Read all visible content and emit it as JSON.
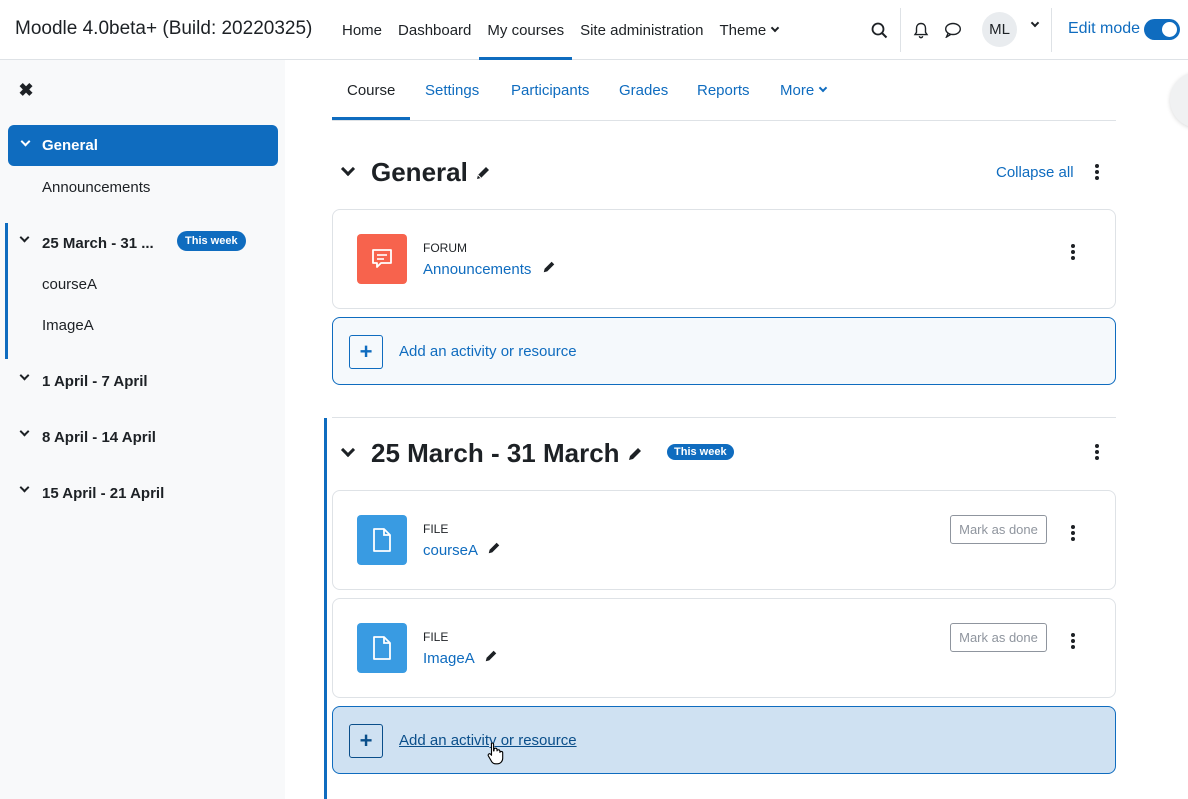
{
  "navbar": {
    "brand": "Moodle 4.0beta+ (Build: 20220325)",
    "items": [
      {
        "label": "Home"
      },
      {
        "label": "Dashboard"
      },
      {
        "label": "My courses"
      },
      {
        "label": "Site administration"
      },
      {
        "label": "Theme"
      }
    ],
    "active_item": "My courses",
    "user_initials": "ML",
    "edit_mode_label": "Edit mode",
    "edit_mode_on": true
  },
  "drawer": {
    "sections": [
      {
        "label": "General",
        "active": true,
        "items": [
          "Announcements"
        ]
      },
      {
        "label": "25 March - 31 ...",
        "badge": "This week",
        "items": [
          "courseA",
          "ImageA"
        ]
      },
      {
        "label": "1 April - 7 April"
      },
      {
        "label": "8 April - 14 April"
      },
      {
        "label": "15 April - 21 April"
      }
    ]
  },
  "tabs": [
    {
      "label": "Course"
    },
    {
      "label": "Settings"
    },
    {
      "label": "Participants"
    },
    {
      "label": "Grades"
    },
    {
      "label": "Reports"
    },
    {
      "label": "More"
    }
  ],
  "main": {
    "collapse_all": "Collapse all",
    "sections": [
      {
        "title": "General",
        "activities": [
          {
            "type": "FORUM",
            "name": "Announcements"
          }
        ],
        "add_label": "Add an activity or resource"
      },
      {
        "title": "25 March - 31 March",
        "badge": "This week",
        "activities": [
          {
            "type": "FILE",
            "name": "courseA",
            "mark_done": "Mark as done"
          },
          {
            "type": "FILE",
            "name": "ImageA",
            "mark_done": "Mark as done"
          }
        ],
        "add_label": "Add an activity or resource"
      }
    ]
  },
  "colors": {
    "primary": "#0f6cbf",
    "forum_icon": "#f7634d",
    "file_icon": "#399be2"
  }
}
